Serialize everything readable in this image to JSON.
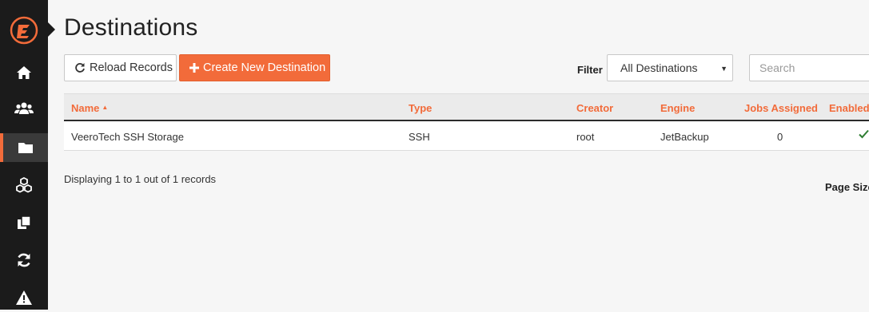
{
  "header": {
    "title": "Destinations"
  },
  "toolbar": {
    "reload_label": "Reload Records",
    "create_label": "Create New Destination",
    "filter_label": "Filter",
    "filter_selected": "All Destinations",
    "search_placeholder": "Search"
  },
  "table": {
    "columns": [
      "Name",
      "Type",
      "Creator",
      "Engine",
      "Jobs Assigned",
      "Enabled"
    ],
    "sort": {
      "column": "Name",
      "direction": "ascending"
    },
    "rows": [
      {
        "name": "VeeroTech SSH Storage",
        "type": "SSH",
        "creator": "root",
        "engine": "JetBackup",
        "jobs_assigned": "0",
        "enabled": "checkmark"
      }
    ]
  },
  "footer": {
    "records_text": "Displaying 1 to 1 out of 1 records",
    "page_size_label": "Page Size"
  },
  "sidebar": {
    "items": [
      {
        "icon": "home-icon"
      },
      {
        "icon": "users-icon"
      },
      {
        "icon": "folder-icon",
        "active": true
      },
      {
        "icon": "cubes-icon"
      },
      {
        "icon": "copy-icon"
      },
      {
        "icon": "refresh-icon"
      },
      {
        "icon": "warning-icon"
      }
    ]
  },
  "colors": {
    "accent": "#f26b3a",
    "sidebar": "#1b1b1b",
    "enabled_check": "#2e7d32"
  }
}
